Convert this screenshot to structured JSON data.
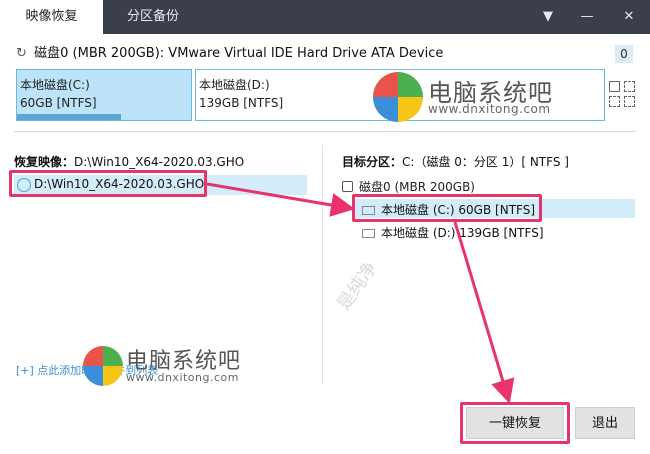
{
  "tabs": [
    "映像恢复",
    "分区备份"
  ],
  "window_controls": {
    "dropdown": "▼",
    "minimize": "—",
    "close": "✕"
  },
  "disk": {
    "label": "磁盘0 (MBR 200GB): VMware Virtual IDE Hard Drive ATA Device",
    "count_badge": "0",
    "partitions": [
      {
        "name": "本地磁盘(C:)",
        "size": "60GB [NTFS]",
        "used_fraction": 0.6,
        "selected": true
      },
      {
        "name": "本地磁盘(D:)",
        "size": "139GB [NTFS]",
        "used_fraction": 0.0,
        "selected": false
      }
    ]
  },
  "left": {
    "restore_label": "恢复映像：",
    "restore_value": "D:\\Win10_X64-2020.03.GHO",
    "file_item": "D:\\Win10_X64-2020.03.GHO",
    "add_link": "[+] 点此添加映像文件到列表"
  },
  "right": {
    "target_label": "目标分区：",
    "target_value": "C:（磁盘 0：分区 1）[ NTFS ]",
    "tree": {
      "root": "磁盘0 (MBR 200GB)",
      "items": [
        "本地磁盘 (C:) 60GB [NTFS]",
        "本地磁盘 (D:) 139GB [NTFS]"
      ]
    }
  },
  "buttons": {
    "restore": "一键恢复",
    "exit": "退出"
  },
  "watermark": {
    "brand": "电脑系统吧",
    "url": "www.dnxitong.com",
    "diagonal": "是纯净",
    "logo_colors": [
      "#e8534a",
      "#4caf50",
      "#3b8fd9",
      "#f5c518"
    ]
  },
  "colors": {
    "titlebar": "#3a3f4b",
    "selection": "#bde3f8",
    "highlight": "#e8346b",
    "link": "#3a8fd0"
  }
}
